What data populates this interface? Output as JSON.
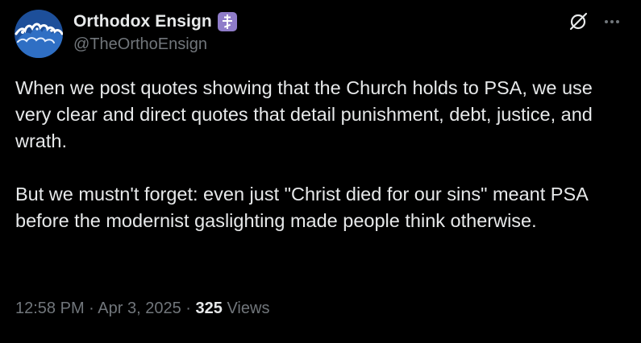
{
  "author": {
    "display_name": "Orthodox Ensign",
    "handle": "@TheOrthoEnsign",
    "avatar_icon": "wave-avatar-icon",
    "badge_icon": "orthodox-cross-icon",
    "badge_color": "#8f7cc9"
  },
  "actions": {
    "grok_icon": "grok-icon",
    "more_icon": "more-options-icon"
  },
  "post": {
    "paragraphs": [
      "When we post quotes showing that the Church holds to PSA, we use very clear and direct quotes that detail punishment, debt, justice, and wrath.",
      "But we mustn't forget: even just \"Christ died for our sins\" meant PSA before the modernist gaslighting made people think otherwise."
    ]
  },
  "meta": {
    "time": "12:58 PM",
    "date": "Apr 3, 2025",
    "separator": "·",
    "views_count": "325",
    "views_label": "Views"
  },
  "colors": {
    "background": "#000000",
    "primary_text": "#e7e9ea",
    "secondary_text": "#71767b"
  }
}
